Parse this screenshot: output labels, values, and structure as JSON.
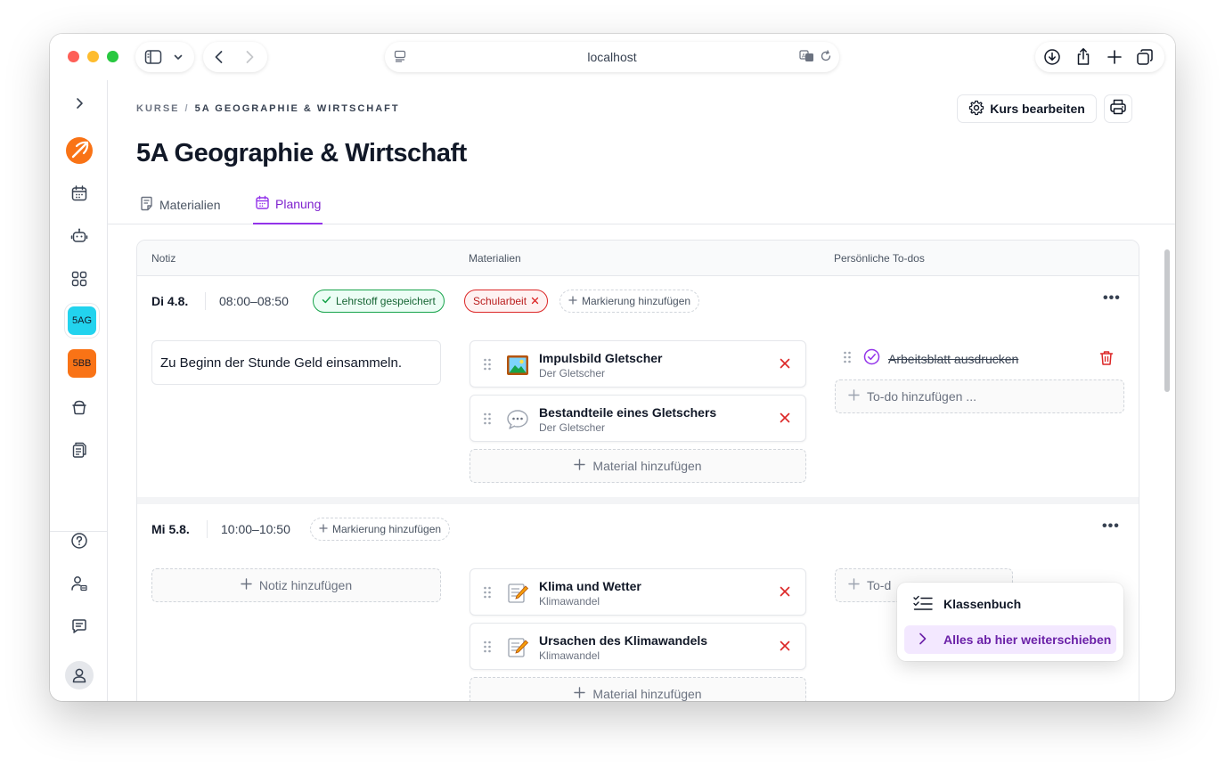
{
  "browser": {
    "url": "localhost"
  },
  "sidebar": {
    "courses": [
      {
        "label": "5AG",
        "color": "#22d3ee"
      },
      {
        "label": "5BB",
        "color": "#f97316"
      }
    ]
  },
  "header": {
    "breadcrumb": [
      "KURSE",
      "/",
      "5A GEOGRAPHIE & WIRTSCHAFT"
    ],
    "title": "5A Geographie & Wirtschaft",
    "edit_label": "Kurs bearbeiten"
  },
  "tabs": [
    {
      "label": "Materialien",
      "active": false
    },
    {
      "label": "Planung",
      "active": true
    }
  ],
  "table": {
    "columns": [
      "Notiz",
      "Materialien",
      "Persönliche To-dos"
    ],
    "rows": [
      {
        "date": "Di 4.8.",
        "time": "08:00–08:50",
        "badges": [
          {
            "label": "Lehrstoff gespeichert",
            "kind": "success"
          },
          {
            "label": "Schularbeit",
            "kind": "danger"
          }
        ],
        "add_mark_label": "Markierung hinzufügen",
        "note": "Zu Beginn der Stunde Geld einsammeln.",
        "materials": [
          {
            "title": "Impulsbild Gletscher",
            "subtitle": "Der Gletscher",
            "icon": "picture-icon"
          },
          {
            "title": "Bestandteile eines Gletschers",
            "subtitle": "Der Gletscher",
            "icon": "speech-bubble-icon"
          }
        ],
        "add_material_label": "Material hinzufügen",
        "todos": [
          {
            "label": "Arbeitsblatt ausdrucken",
            "done": true
          }
        ],
        "add_todo_label": "To-do hinzufügen ..."
      },
      {
        "date": "Mi 5.8.",
        "time": "10:00–10:50",
        "add_mark_label": "Markierung hinzufügen",
        "add_note_label": "Notiz hinzufügen",
        "materials": [
          {
            "title": "Klima und Wetter",
            "subtitle": "Klimawandel",
            "icon": "memo-icon"
          },
          {
            "title": "Ursachen des Klimawandels",
            "subtitle": "Klimawandel",
            "icon": "memo-icon"
          }
        ],
        "add_material_label": "Material hinzufügen",
        "add_todo_label": "To-d"
      }
    ]
  },
  "context_menu": {
    "items": [
      {
        "label": "Klassenbuch",
        "active": false
      },
      {
        "label": "Alles ab hier weiterschieben",
        "active": true
      }
    ]
  },
  "colors": {
    "accent": "#9333ea",
    "success": "#16a34a",
    "danger": "#dc2626"
  }
}
